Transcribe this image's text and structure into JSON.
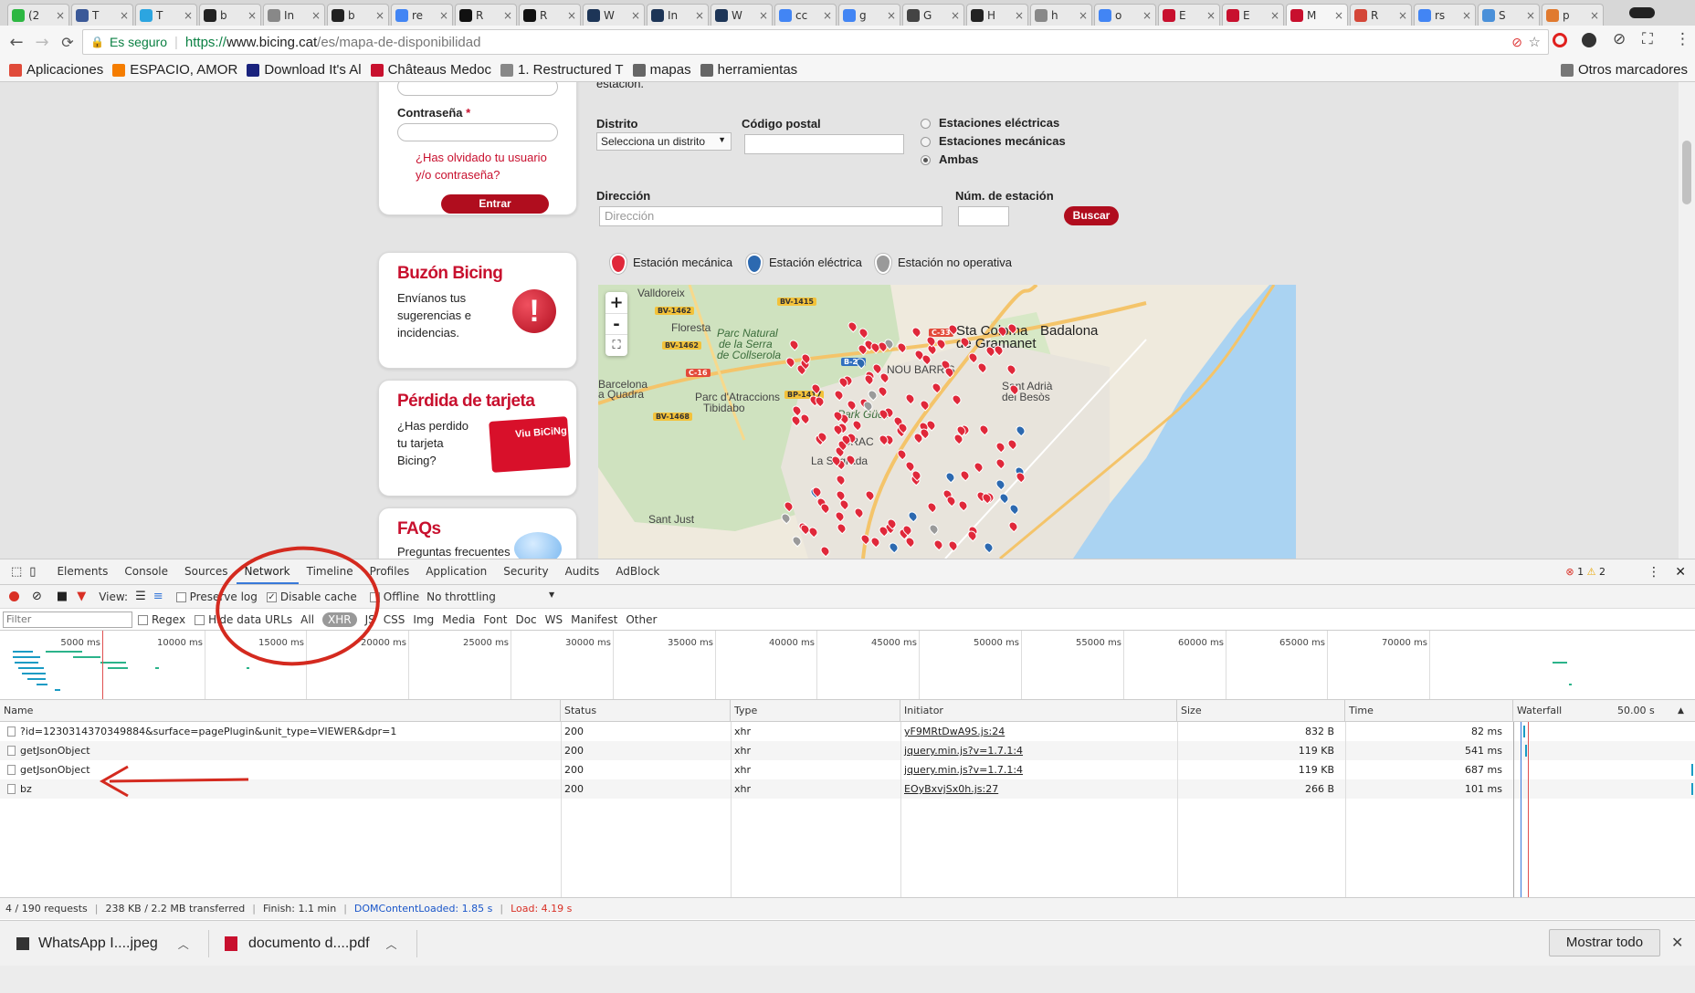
{
  "browser": {
    "tabs": [
      {
        "label": "(2",
        "color": "#2db742",
        "active": false
      },
      {
        "label": "T",
        "color": "#3b5998",
        "active": false
      },
      {
        "label": "T",
        "color": "#2ca5e0",
        "active": false
      },
      {
        "label": "b",
        "color": "#222222",
        "active": false
      },
      {
        "label": "In",
        "color": "#888888",
        "active": false
      },
      {
        "label": "b",
        "color": "#222222",
        "active": false
      },
      {
        "label": "re",
        "color": "#4285f4",
        "active": false
      },
      {
        "label": "R",
        "color": "#111111",
        "active": false
      },
      {
        "label": "R",
        "color": "#111111",
        "active": false
      },
      {
        "label": "W",
        "color": "#1d3557",
        "active": false
      },
      {
        "label": "In",
        "color": "#1d3557",
        "active": false
      },
      {
        "label": "W",
        "color": "#1d3557",
        "active": false
      },
      {
        "label": "cc",
        "color": "#4285f4",
        "active": false
      },
      {
        "label": "g",
        "color": "#4285f4",
        "active": false
      },
      {
        "label": "G",
        "color": "#444444",
        "active": false
      },
      {
        "label": "H",
        "color": "#222222",
        "active": false
      },
      {
        "label": "h",
        "color": "#888888",
        "active": false
      },
      {
        "label": "o",
        "color": "#4285f4",
        "active": false
      },
      {
        "label": "E",
        "color": "#c8102e",
        "active": false
      },
      {
        "label": "E",
        "color": "#c8102e",
        "active": false
      },
      {
        "label": "M",
        "color": "#c8102e",
        "active": true
      },
      {
        "label": "R",
        "color": "#d44638",
        "active": false
      },
      {
        "label": "rs",
        "color": "#4285f4",
        "active": false
      },
      {
        "label": "S",
        "color": "#4a90d9",
        "active": false
      },
      {
        "label": "p",
        "color": "#e07a2f",
        "active": false
      }
    ],
    "secure_label": "Es seguro",
    "url_scheme": "https://",
    "url_host": "www.bicing.cat",
    "url_path": "/es/mapa-de-disponibilidad",
    "bookmarks": [
      {
        "label": "Aplicaciones",
        "color": "#e04b3a"
      },
      {
        "label": "ESPACIO, AMOR",
        "color": "#f57d00"
      },
      {
        "label": "Download It's Al",
        "color": "#1a237e"
      },
      {
        "label": "Châteaus Medoc",
        "color": "#c8102e"
      },
      {
        "label": "1. Restructured T",
        "color": "#888888"
      },
      {
        "label": "mapas",
        "color": "#666666"
      },
      {
        "label": "herramientas",
        "color": "#666666"
      }
    ],
    "other_bookmarks": "Otros marcadores"
  },
  "login": {
    "password_label": "Contraseña",
    "required_mark": "*",
    "forgot_line1": "¿Has olvidado tu usuario",
    "forgot_line2": "y/o contraseña?",
    "submit_label": "Entrar"
  },
  "cards": {
    "mailbox": {
      "title": "Buzón Bicing",
      "text": "Envíanos tus sugerencias e incidencias."
    },
    "lost_card": {
      "title": "Pérdida de tarjeta",
      "text": "¿Has perdido tu tarjeta Bicing?",
      "card_label": "Viu BiCiNg"
    },
    "faqs": {
      "title": "FAQs",
      "text": "Preguntas frecuentes"
    }
  },
  "search": {
    "intro_tail": "estación.",
    "district_label": "Distrito",
    "district_value": "Selecciona un distrito",
    "postal_label": "Código postal",
    "radio_electric": "Estaciones eléctricas",
    "radio_mechanical": "Estaciones mecánicas",
    "radio_both": "Ambas",
    "address_label": "Dirección",
    "address_placeholder": "Dirección",
    "station_num_label": "Núm. de estación",
    "search_button": "Buscar",
    "legend_mechanical": "Estación mecánica",
    "legend_electric": "Estación eléctrica",
    "legend_inactive": "Estación no operativa"
  },
  "map": {
    "places": [
      "Valldoreix",
      "Floresta",
      "Parc Natural",
      "de la Serra",
      "de Collserola",
      "Barcelona",
      "a Quadra",
      "Parc d'Atraccions",
      "Tibidabo",
      "Park Güell",
      "GRAC",
      "Sta Coloma",
      "de Gramanet",
      "Badalona",
      "Sant Adrià",
      "del Besòs",
      "NOU BARRIS",
      "La Sagrada",
      "Sant Just"
    ],
    "roads": [
      "BV-1415",
      "BV-1462",
      "BV-1462",
      "C-16",
      "BV-1468",
      "C-33",
      "B-20",
      "BP-1417"
    ],
    "zoom_in": "+",
    "zoom_out": "-",
    "colors": {
      "mechanical": "#e0283a",
      "electric": "#2c69b0",
      "inactive": "#9a9a9a",
      "land": "#efeadd",
      "park": "#cfe2bf",
      "sea": "#aad3f2"
    }
  },
  "devtools": {
    "tabs": [
      "Elements",
      "Console",
      "Sources",
      "Network",
      "Timeline",
      "Profiles",
      "Application",
      "Security",
      "Audits",
      "AdBlock"
    ],
    "active_tab": "Network",
    "errors": "1",
    "warnings": "2",
    "view_label": "View:",
    "preserve_log": "Preserve log",
    "disable_cache": "Disable cache",
    "offline": "Offline",
    "throttling": "No throttling",
    "filter_placeholder": "Filter",
    "regex": "Regex",
    "hide_data_urls": "Hide data URLs",
    "types": [
      "All",
      "XHR",
      "JS",
      "CSS",
      "Img",
      "Media",
      "Font",
      "Doc",
      "WS",
      "Manifest",
      "Other"
    ],
    "selected_type": "XHR",
    "overview_ticks": [
      "5000 ms",
      "10000 ms",
      "15000 ms",
      "20000 ms",
      "25000 ms",
      "30000 ms",
      "35000 ms",
      "40000 ms",
      "45000 ms",
      "50000 ms",
      "55000 ms",
      "60000 ms",
      "65000 ms",
      "70000 ms"
    ],
    "columns": {
      "name": "Name",
      "status": "Status",
      "type": "Type",
      "initiator": "Initiator",
      "size": "Size",
      "time": "Time",
      "waterfall": "Waterfall",
      "waterfall_scale": "50.00 s"
    },
    "requests": [
      {
        "name": "?id=1230314370349884&surface=pagePlugin&unit_type=VIEWER&dpr=1",
        "status": "200",
        "type": "xhr",
        "initiator": "yF9MRtDwA9S.js:24",
        "size": "832 B",
        "time": "82 ms"
      },
      {
        "name": "getJsonObject",
        "status": "200",
        "type": "xhr",
        "initiator": "jquery.min.js?v=1.7.1:4",
        "size": "119 KB",
        "time": "541 ms"
      },
      {
        "name": "getJsonObject",
        "status": "200",
        "type": "xhr",
        "initiator": "jquery.min.js?v=1.7.1:4",
        "size": "119 KB",
        "time": "687 ms"
      },
      {
        "name": "bz",
        "status": "200",
        "type": "xhr",
        "initiator": "EOyBxvjSx0h.js:27",
        "size": "266 B",
        "time": "101 ms"
      }
    ],
    "summary": {
      "requests": "4 / 190 requests",
      "transferred": "238 KB / 2.2 MB transferred",
      "finish": "Finish: 1.1 min",
      "dom": "DOMContentLoaded: 1.85 s",
      "load": "Load: 4.19 s"
    }
  },
  "downloads": {
    "items": [
      "WhatsApp I....jpeg",
      "documento d....pdf"
    ],
    "show_all": "Mostrar todo"
  },
  "annotations": {
    "color": "#d42a1f"
  }
}
